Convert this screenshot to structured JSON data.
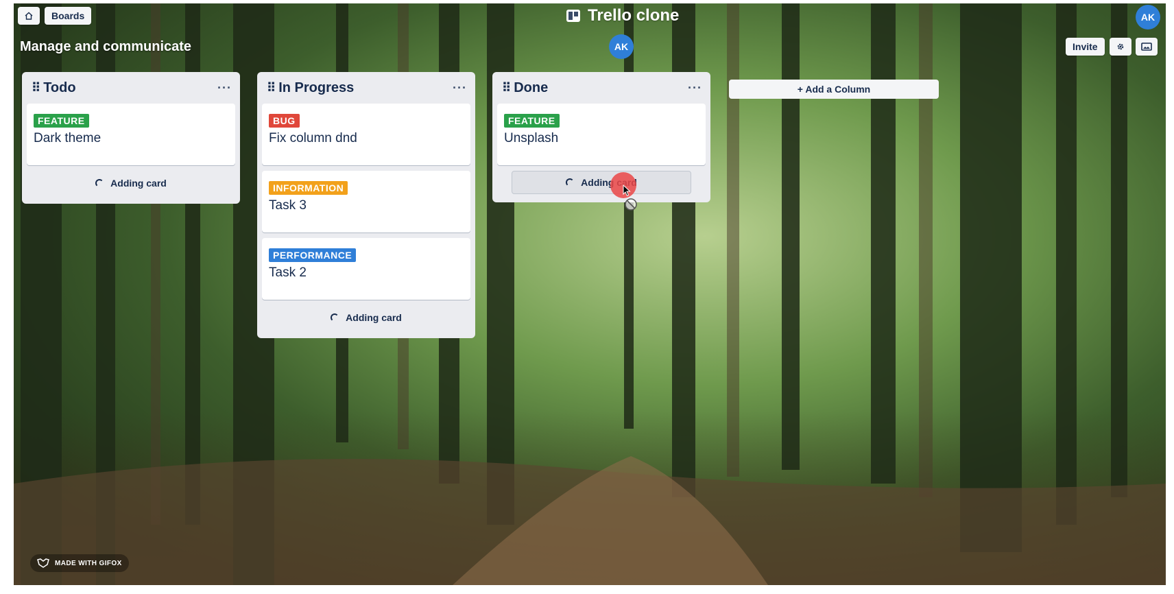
{
  "app": {
    "title": "Trello clone"
  },
  "topbar": {
    "home_icon": "home-icon",
    "boards_label": "Boards",
    "avatar_initials": "AK"
  },
  "board": {
    "name": "Manage and communicate",
    "member_initials": "AK",
    "invite_label": "Invite",
    "settings_icon": "gear-icon",
    "background_icon": "image-icon",
    "add_column_label": "+ Add a Column"
  },
  "columns": [
    {
      "title": "Todo",
      "cards": [
        {
          "label": "FEATURE",
          "label_color": "#2aa14a",
          "title": "Dark theme"
        }
      ],
      "adding_label": "Adding card"
    },
    {
      "title": "In Progress",
      "cards": [
        {
          "label": "BUG",
          "label_color": "#e0473a",
          "title": "Fix column dnd"
        },
        {
          "label": "INFORMATION",
          "label_color": "#f2a11b",
          "title": "Task 3"
        },
        {
          "label": "PERFORMANCE",
          "label_color": "#2f7fd8",
          "title": "Task 2"
        }
      ],
      "adding_label": "Adding card"
    },
    {
      "title": "Done",
      "cards": [
        {
          "label": "FEATURE",
          "label_color": "#2aa14a",
          "title": "Unsplash"
        }
      ],
      "adding_label": "Adding card"
    }
  ],
  "watermark": {
    "text": "MADE WITH GIFOX"
  },
  "colors": {
    "avatar": "#2f7fd8",
    "column_bg": "#ebecf0",
    "text": "#172b4d"
  }
}
